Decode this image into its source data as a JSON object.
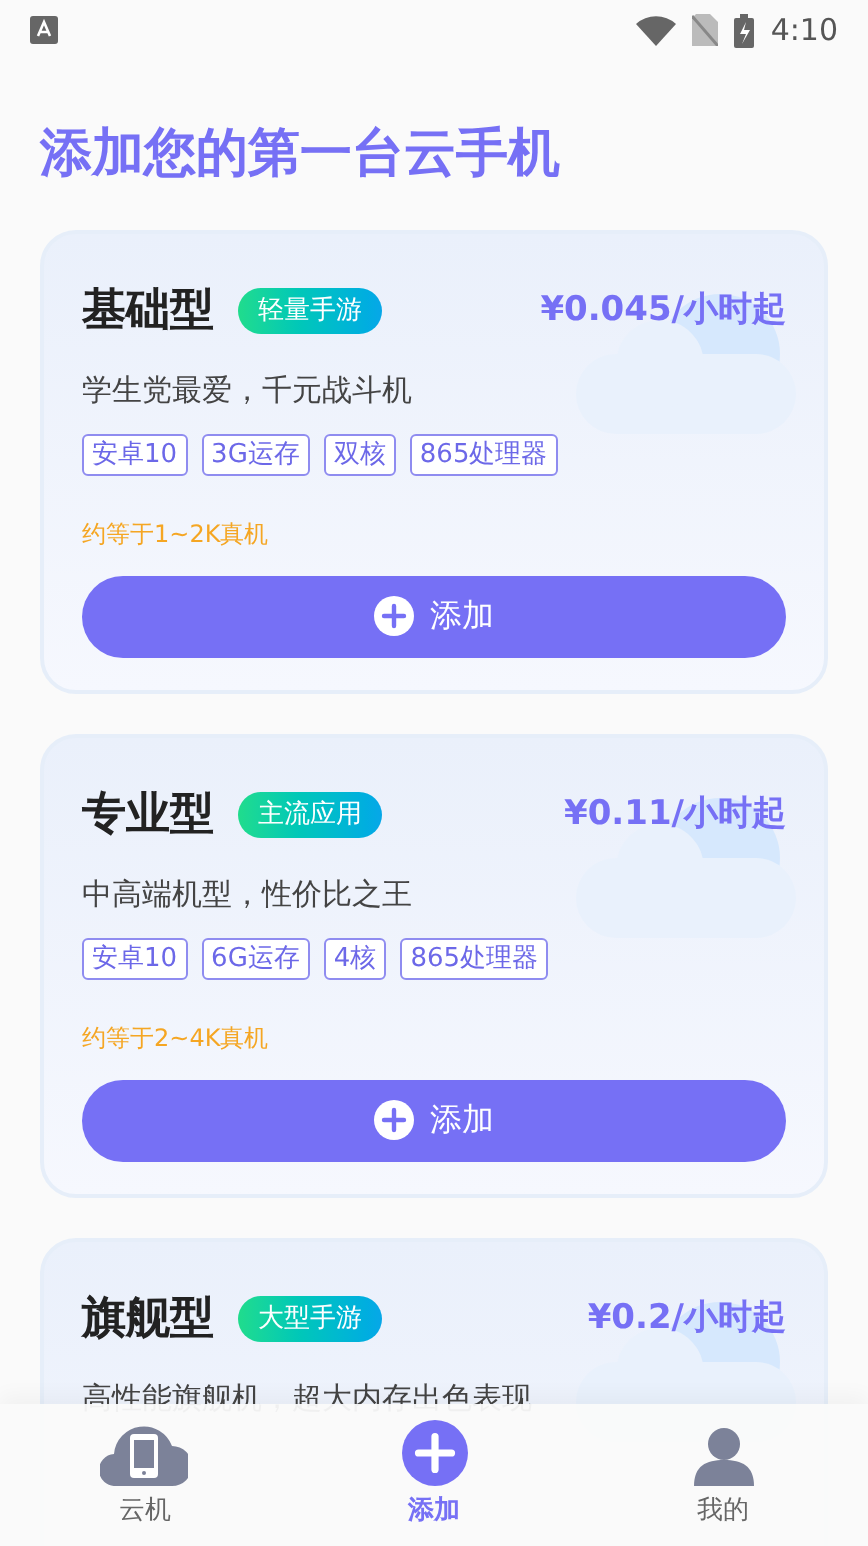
{
  "status_bar": {
    "time": "4:10"
  },
  "title": "添加您的第一台云手机",
  "plans": [
    {
      "name": "基础型",
      "badge": "轻量手游",
      "price": "¥0.045/小时起",
      "description": "学生党最爱，千元战斗机",
      "specs": [
        "安卓10",
        "3G运存",
        "双核",
        "865处理器"
      ],
      "equivalent": "约等于1~2K真机",
      "button": "添加"
    },
    {
      "name": "专业型",
      "badge": "主流应用",
      "price": "¥0.11/小时起",
      "description": "中高端机型，性价比之王",
      "specs": [
        "安卓10",
        "6G运存",
        "4核",
        "865处理器"
      ],
      "equivalent": "约等于2~4K真机",
      "button": "添加"
    },
    {
      "name": "旗舰型",
      "badge": "大型手游",
      "price": "¥0.2/小时起",
      "description": "高性能旗舰机，超大内存出色表现"
    }
  ],
  "nav": [
    {
      "kind": "cloud",
      "label": "云机",
      "selected": false
    },
    {
      "kind": "add",
      "label": "添加",
      "selected": true
    },
    {
      "kind": "user",
      "label": "我的",
      "selected": false
    }
  ]
}
